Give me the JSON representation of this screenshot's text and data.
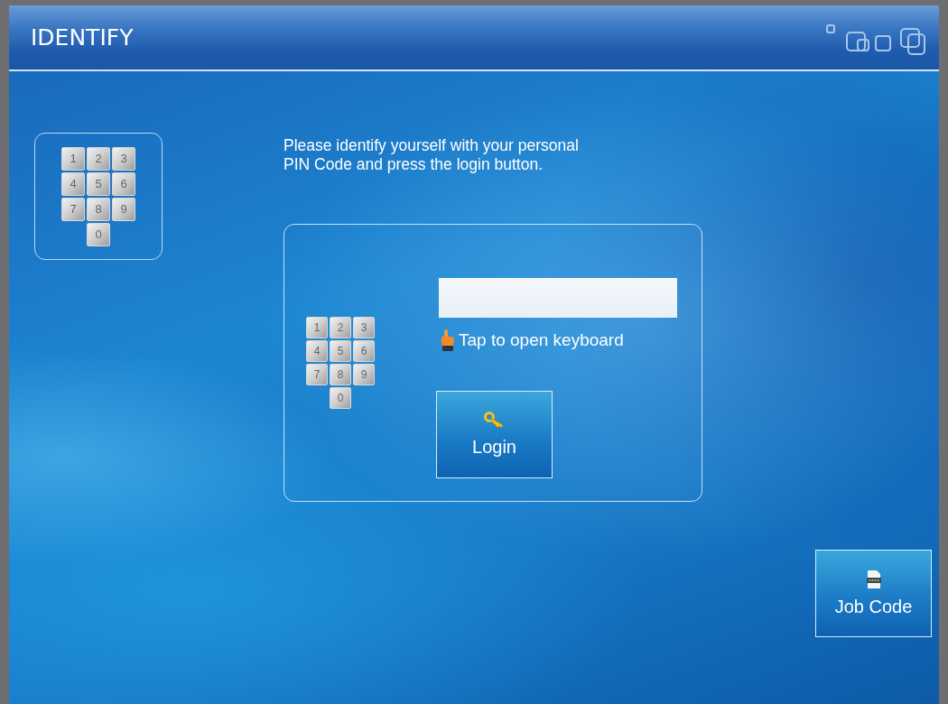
{
  "header": {
    "title": "IDENTIFY"
  },
  "keypad_card": {
    "keys": [
      "1",
      "2",
      "3",
      "4",
      "5",
      "6",
      "7",
      "8",
      "9",
      "0"
    ]
  },
  "instruction": "Please identify yourself with your personal\nPIN Code and press the login button.",
  "login_panel": {
    "keypad_keys": [
      "1",
      "2",
      "3",
      "4",
      "5",
      "6",
      "7",
      "8",
      "9",
      "0"
    ],
    "hint": "Tap to open keyboard",
    "login_button": "Login"
  },
  "job_code_button": "Job Code"
}
